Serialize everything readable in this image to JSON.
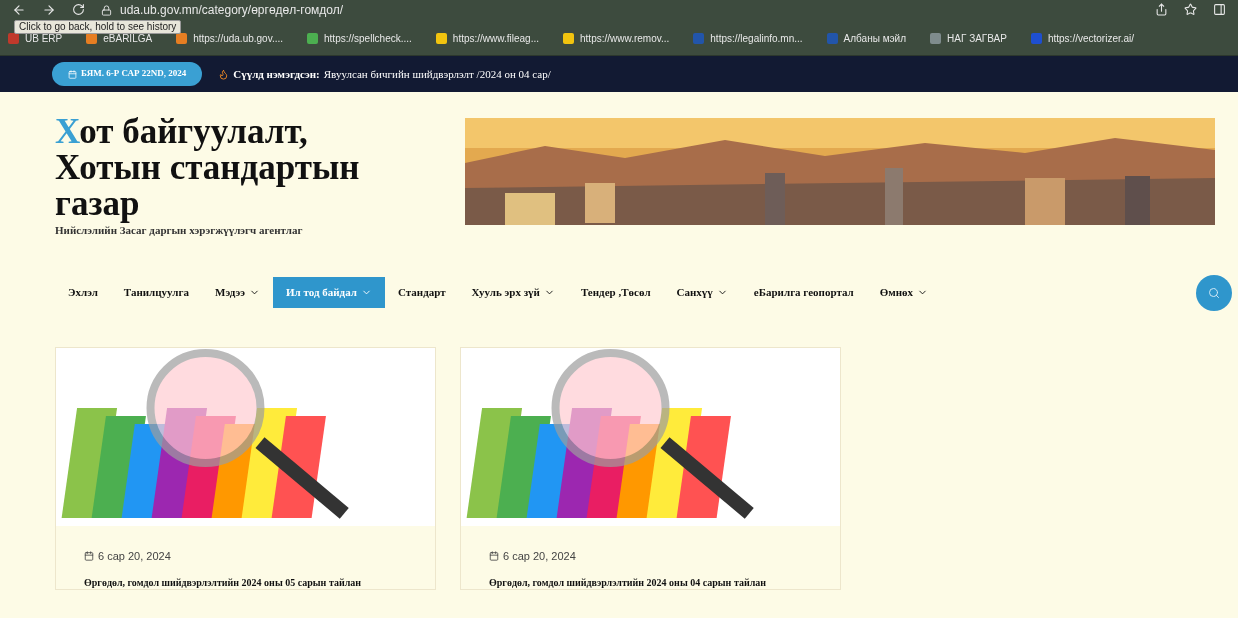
{
  "browser": {
    "url": "uda.ub.gov.mn/category/өргөдөл-гомдол/",
    "tooltip": "Click to go back, hold to see history",
    "bookmarks": [
      {
        "label": "UB ERP",
        "color": "#c0392b"
      },
      {
        "label": "eBARILGA",
        "color": "#e67e22"
      },
      {
        "label": "https://uda.ub.gov....",
        "color": "#e67e22"
      },
      {
        "label": "https://spellcheck....",
        "color": "#4caf50"
      },
      {
        "label": "https://www.fileag...",
        "color": "#f1c40f"
      },
      {
        "label": "https://www.remov...",
        "color": "#f1c40f"
      },
      {
        "label": "https://legalinfo.mn...",
        "color": "#2255aa"
      },
      {
        "label": "Албаны мэйл",
        "color": "#2255aa"
      },
      {
        "label": "НАГ ЗАГВАР",
        "color": "#7f8c8d"
      },
      {
        "label": "https://vectorizer.ai/",
        "color": "#1e4fd0"
      }
    ]
  },
  "topbar": {
    "date": "БЯМ. 6-Р САР 22ND, 2024",
    "latest_label": "Сүүлд нэмэгдсэн:",
    "latest_text": "Явуулсан бичгийн шийдвэрлэлт /2024 он 04 сар/"
  },
  "site": {
    "title_first": "Х",
    "title_rest": "от байгуулалт, Хотын стандартын газар",
    "subtitle": "Нийслэлийн Засаг даргын хэрэгжүүлэгч агентлаг"
  },
  "nav": [
    {
      "label": "Эхлэл",
      "selected": false,
      "dropdown": false
    },
    {
      "label": "Танилцуулга",
      "selected": false,
      "dropdown": false
    },
    {
      "label": "Мэдээ",
      "selected": false,
      "dropdown": true
    },
    {
      "label": "Ил тод байдал",
      "selected": true,
      "dropdown": true
    },
    {
      "label": "Стандарт",
      "selected": false,
      "dropdown": false
    },
    {
      "label": "Хууль эрх зүй",
      "selected": false,
      "dropdown": true
    },
    {
      "label": "Тендер ,Төсөл",
      "selected": false,
      "dropdown": false
    },
    {
      "label": "Санхүү",
      "selected": false,
      "dropdown": true
    },
    {
      "label": "еБарилга геопортал",
      "selected": false,
      "dropdown": false
    },
    {
      "label": "Өмнөх",
      "selected": false,
      "dropdown": true
    }
  ],
  "posts": [
    {
      "date": "6 сар 20, 2024",
      "title": "Өргөдөл, гомдол шийдвэрлэлтийн 2024 оны 05 сарын тайлан"
    },
    {
      "date": "6 сар 20, 2024",
      "title": "Өргөдөл, гомдол шийдвэрлэлтийн 2024 оны 04 сарын тайлан"
    }
  ]
}
